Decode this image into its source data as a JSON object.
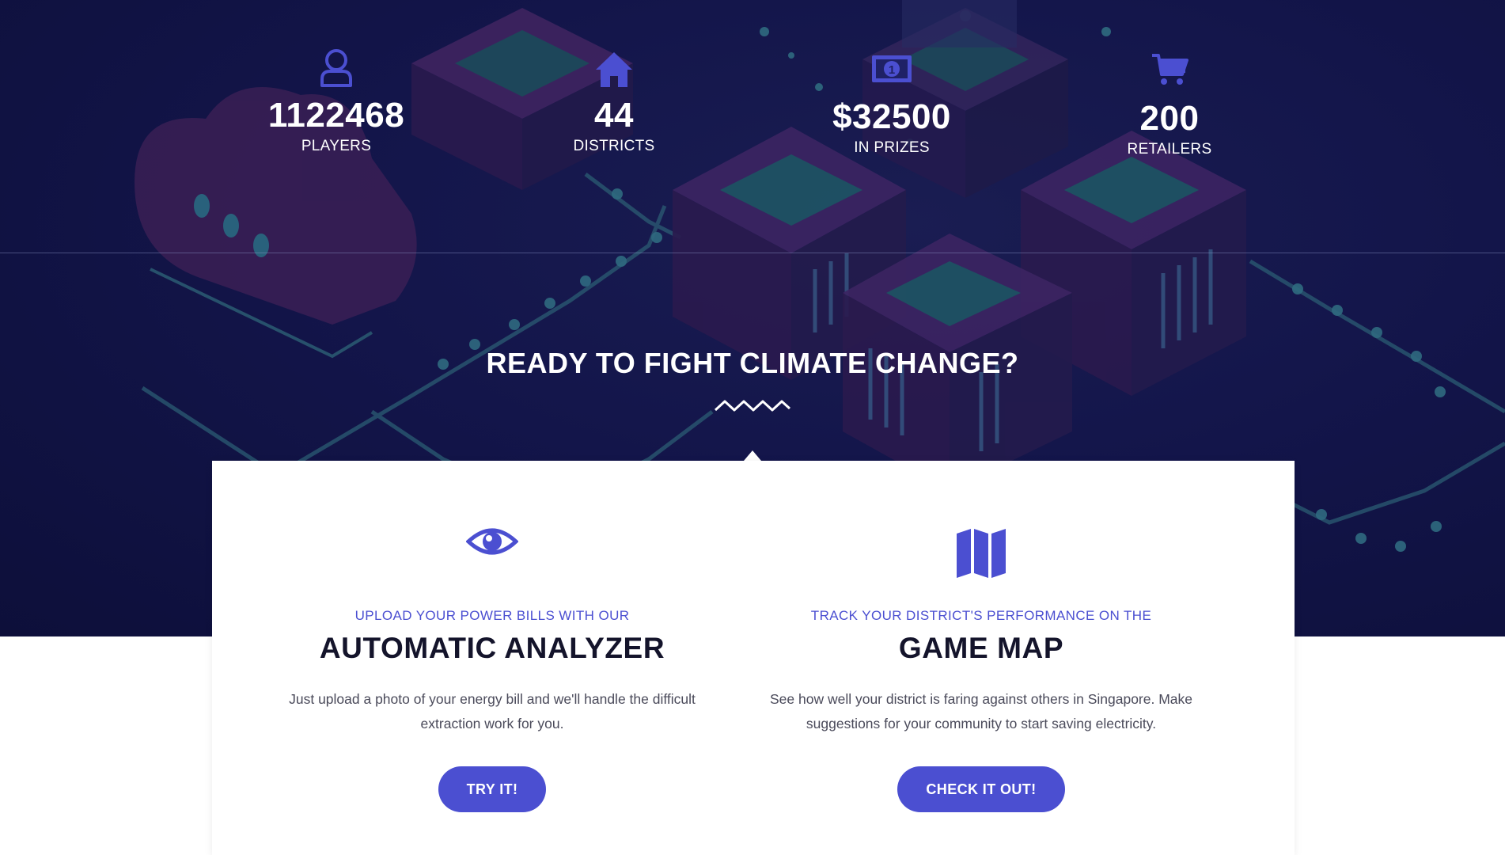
{
  "stats": [
    {
      "icon": "user-icon",
      "value": "1122468",
      "label": "PLAYERS"
    },
    {
      "icon": "home-icon",
      "value": "44",
      "label": "DISTRICTS"
    },
    {
      "icon": "money-bill-icon",
      "value": "$32500",
      "label": "IN PRIZES"
    },
    {
      "icon": "shopping-cart-icon",
      "value": "200",
      "label": "RETAILERS"
    }
  ],
  "cta": {
    "title": "READY TO FIGHT CLIMATE CHANGE?"
  },
  "features": [
    {
      "icon": "eye-icon",
      "eyebrow": "UPLOAD YOUR POWER BILLS WITH OUR",
      "heading": "AUTOMATIC ANALYZER",
      "description_line1": "Just upload a photo of your energy bill and we'll handle the difficult",
      "description_line2": "extraction work for you.",
      "button": "TRY IT!"
    },
    {
      "icon": "map-icon",
      "eyebrow": "TRACK YOUR DISTRICT'S PERFORMANCE ON THE",
      "heading": "GAME MAP",
      "description_line1": "See how well your district is faring against others in Singapore. Make",
      "description_line2": "suggestions for your community to start saving electricity.",
      "button": "CHECK IT OUT!"
    }
  ],
  "colors": {
    "accent": "#4b4fd1",
    "hero_bg": "#13154a",
    "heading": "#14142b"
  }
}
